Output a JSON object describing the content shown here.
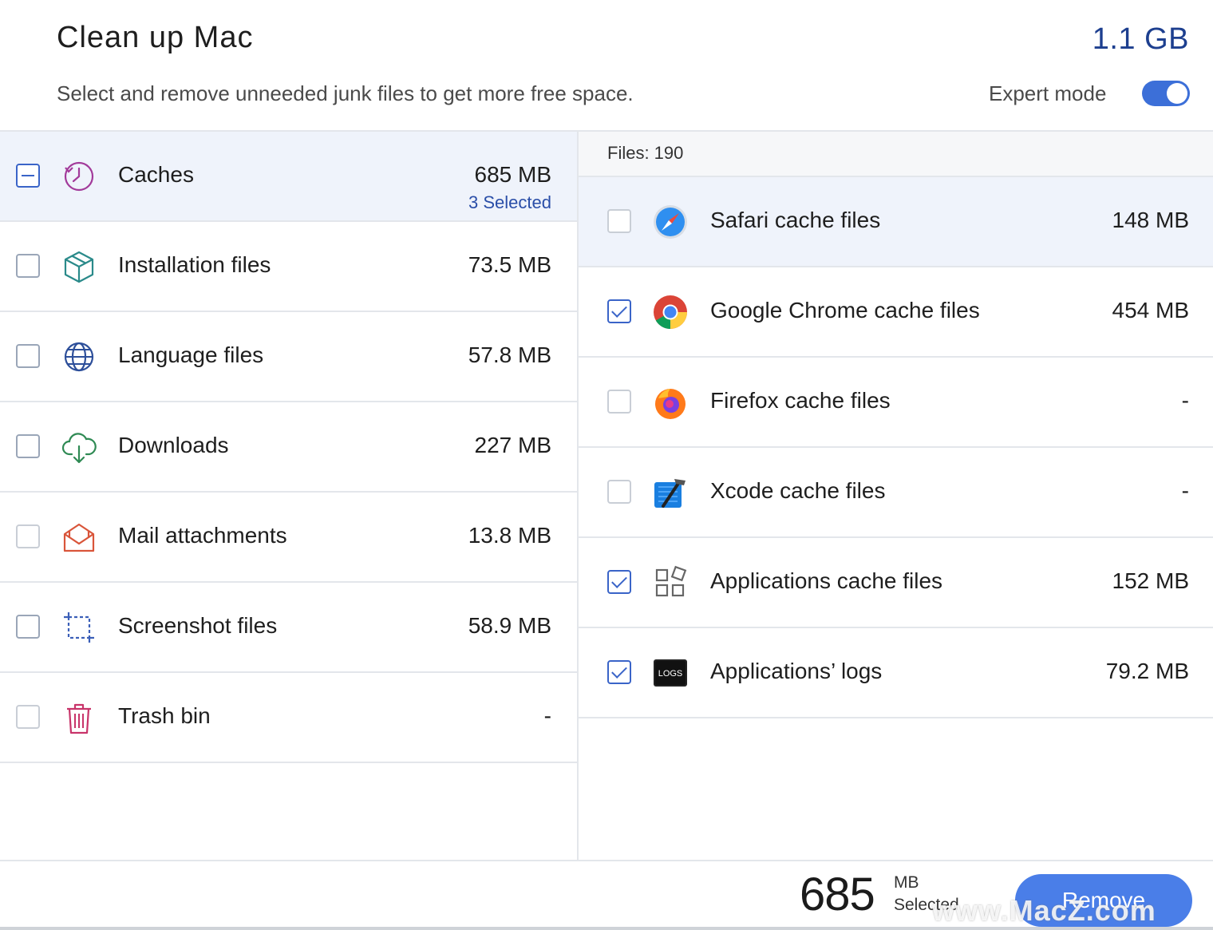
{
  "header": {
    "title": "Clean up Mac",
    "total_size": "1.1 GB",
    "subtitle": "Select and remove unneeded junk files to get more free space.",
    "expert_mode_label": "Expert mode",
    "expert_mode_on": true
  },
  "categories": [
    {
      "label": "Caches",
      "size": "685 MB",
      "sub": "3 Selected",
      "icon": "history-clock-icon",
      "state": "mixed"
    },
    {
      "label": "Installation files",
      "size": "73.5 MB",
      "icon": "package-box-icon",
      "state": "unchecked"
    },
    {
      "label": "Language files",
      "size": "57.8 MB",
      "icon": "globe-icon",
      "state": "unchecked"
    },
    {
      "label": "Downloads",
      "size": "227 MB",
      "icon": "cloud-download-icon",
      "state": "unchecked"
    },
    {
      "label": "Mail attachments",
      "size": "13.8 MB",
      "icon": "mail-open-icon",
      "state": "unchecked"
    },
    {
      "label": "Screenshot files",
      "size": "58.9 MB",
      "icon": "crop-screenshot-icon",
      "state": "unchecked"
    },
    {
      "label": "Trash bin",
      "size": "-",
      "icon": "trash-bin-icon",
      "state": "unchecked"
    }
  ],
  "files_panel": {
    "files_count": "Files: 190",
    "items": [
      {
        "label": "Safari cache files",
        "size": "148 MB",
        "icon": "safari-icon",
        "checked": false
      },
      {
        "label": "Google Chrome cache files",
        "size": "454 MB",
        "icon": "chrome-icon",
        "checked": true
      },
      {
        "label": "Firefox cache files",
        "size": "-",
        "icon": "firefox-icon",
        "checked": false
      },
      {
        "label": "Xcode cache files",
        "size": "-",
        "icon": "xcode-icon",
        "checked": false
      },
      {
        "label": "Applications cache files",
        "size": "152 MB",
        "icon": "app-grid-icon",
        "checked": true
      },
      {
        "label": "Applications’ logs",
        "size": "79.2 MB",
        "icon": "logs-icon",
        "icon_text": "LOGS",
        "checked": true
      }
    ]
  },
  "footer": {
    "selected_amount": "685",
    "selected_unit": "MB",
    "selected_label": "Selected",
    "remove_label": "Remove"
  },
  "watermark": "www.MacZ.com",
  "colors": {
    "accent": "#3c6fd8",
    "selected_row": "#eff3fb",
    "total_size": "#1d3f8f",
    "remove_button": "#4a7ee8"
  }
}
